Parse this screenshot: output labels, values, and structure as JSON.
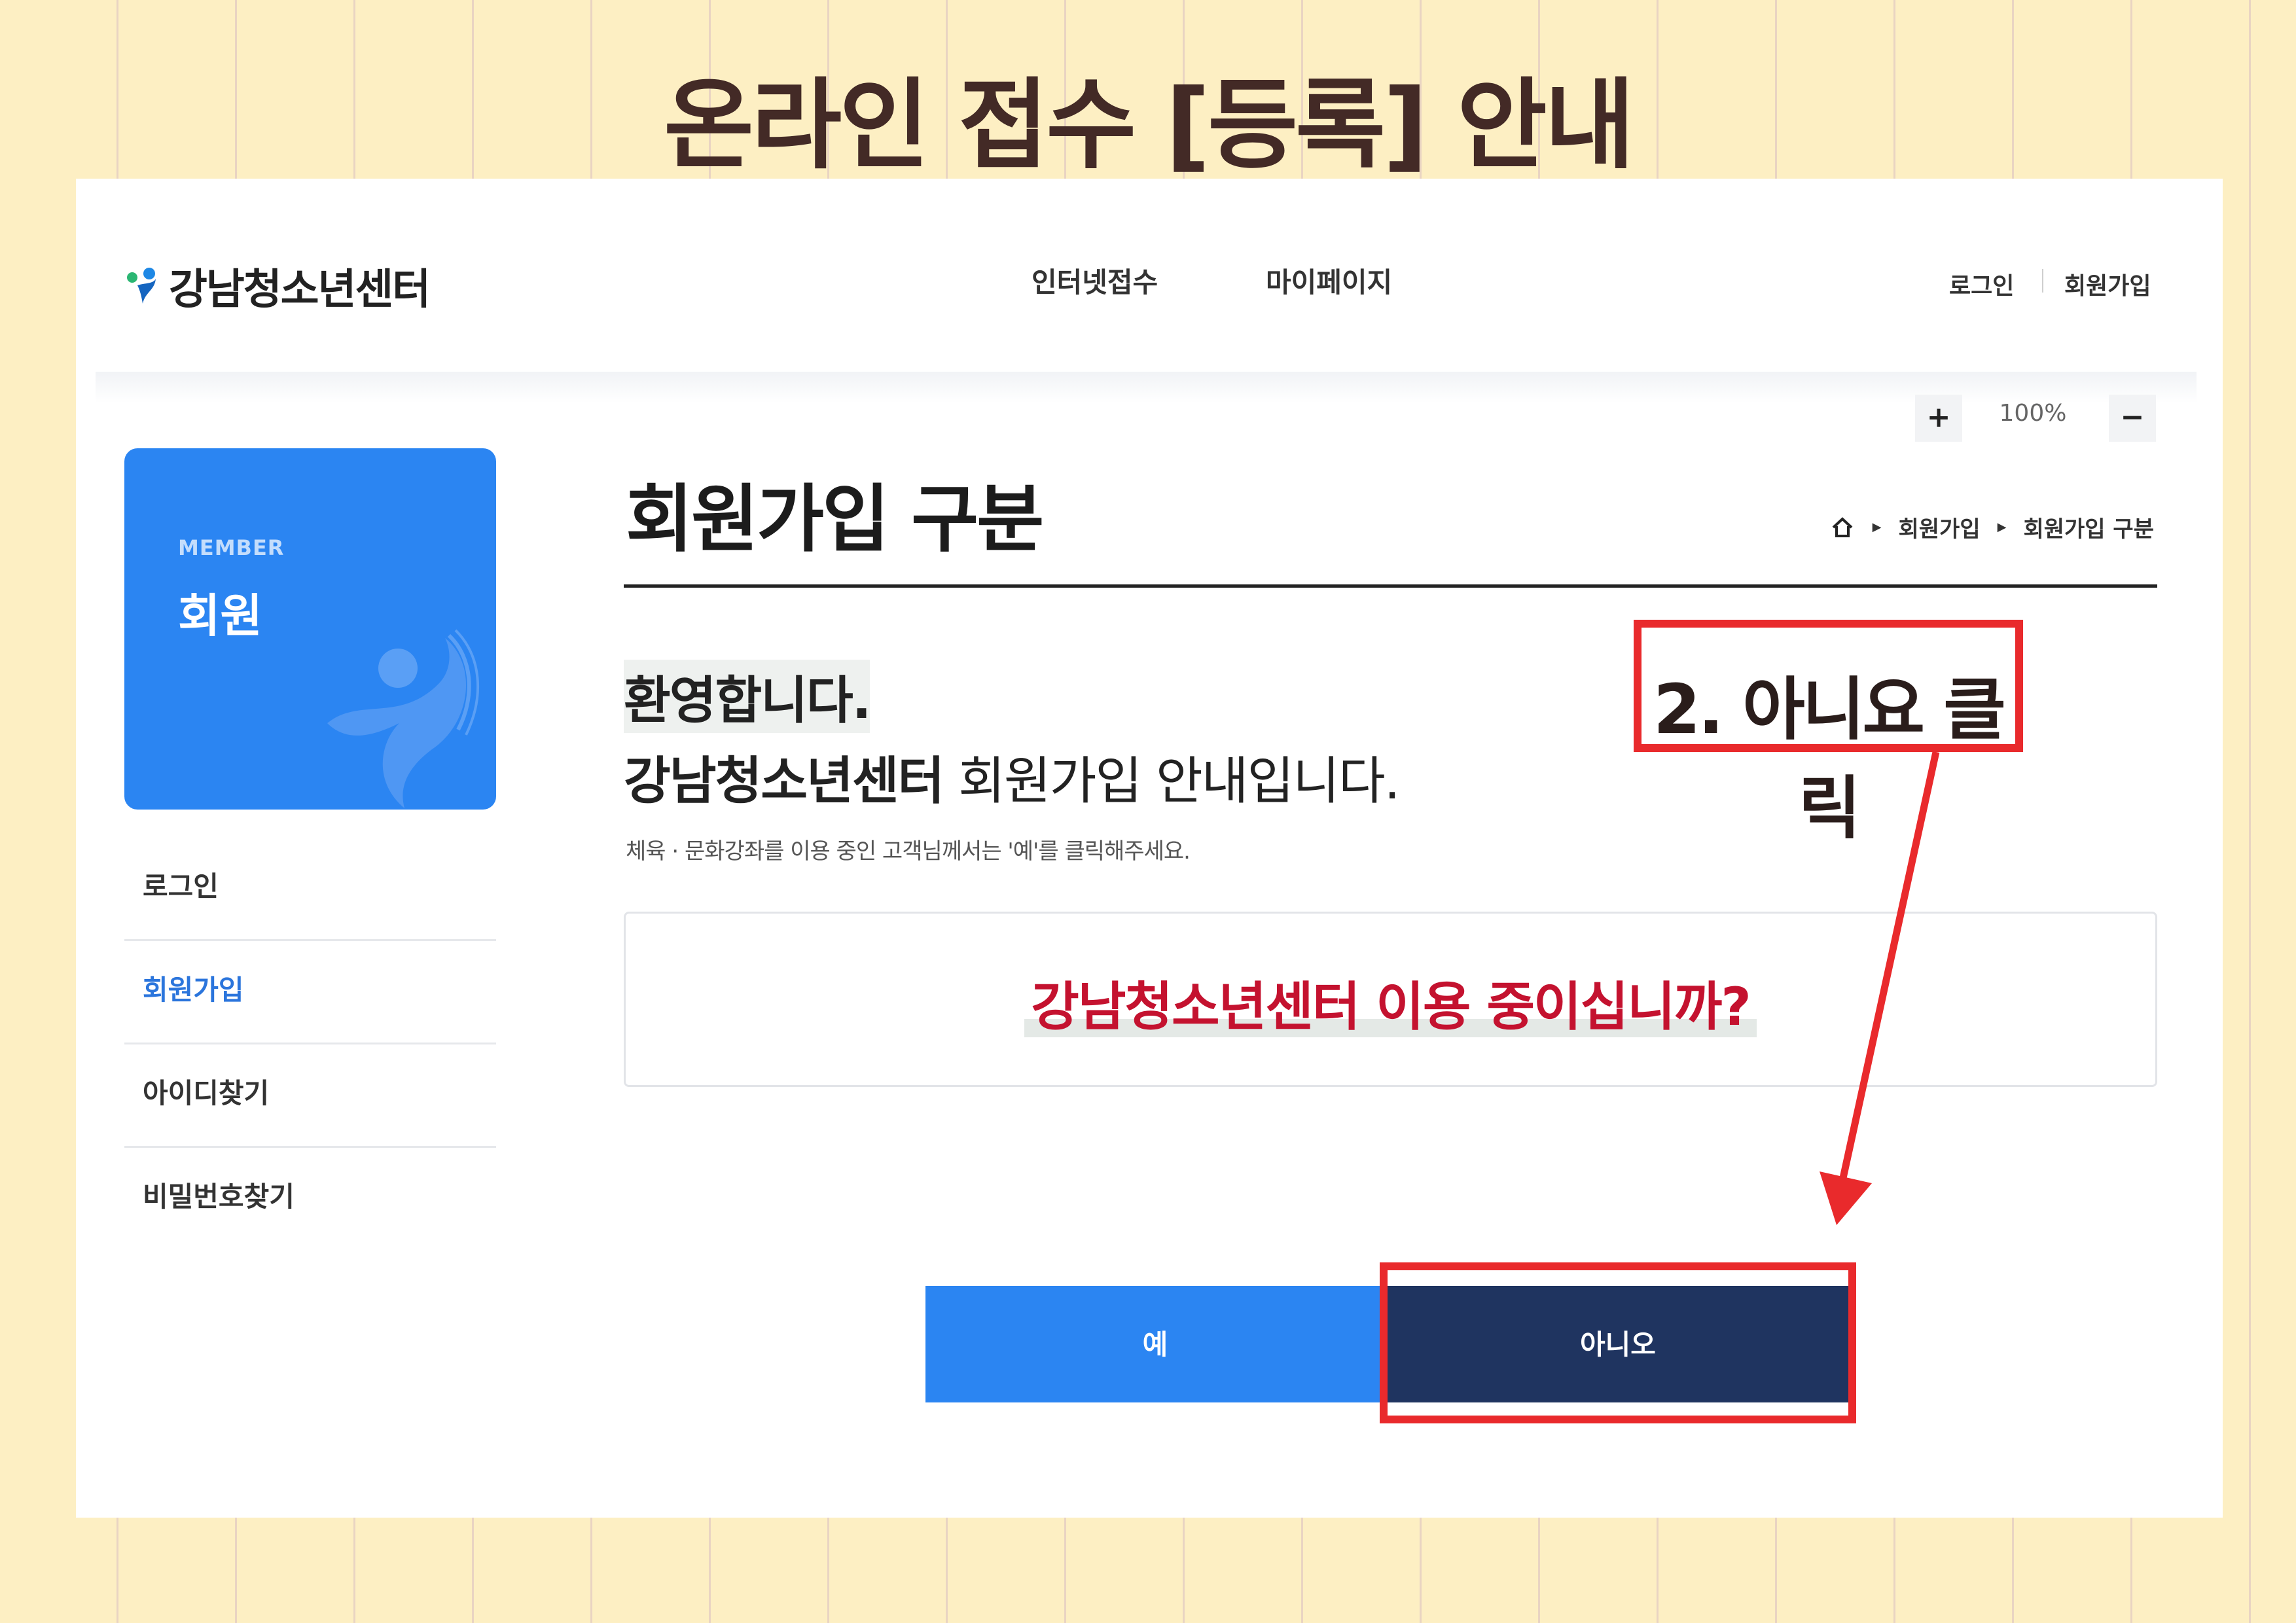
{
  "poster": {
    "title": "온라인 접수 [등록] 안내"
  },
  "header": {
    "logo_text": "강남청소년센터",
    "nav": [
      "인터넷접수",
      "마이페이지"
    ],
    "util": {
      "login": "로그인",
      "signup": "회원가입"
    }
  },
  "zoom": {
    "plus": "+",
    "level": "100%",
    "minus": "−"
  },
  "sidebar": {
    "card": {
      "eyebrow": "MEMBER",
      "heading": "회원"
    },
    "items": [
      {
        "label": "로그인",
        "active": false
      },
      {
        "label": "회원가입",
        "active": true
      },
      {
        "label": "아이디찾기",
        "active": false
      },
      {
        "label": "비밀번호찾기",
        "active": false
      }
    ]
  },
  "content": {
    "title": "회원가입 구분",
    "breadcrumb": [
      "회원가입",
      "회원가입 구분"
    ],
    "welcome": "환영합니다.",
    "intro_bold": "강남청소년센터",
    "intro_rest": " 회원가입 안내입니다.",
    "note": "체육 · 문화강좌를 이용 중인 고객님께서는 '예'를 클릭해주세요.",
    "question": "강남청소년센터 이용 중이십니까?",
    "buttons": {
      "yes": "예",
      "no": "아니오"
    }
  },
  "annotation": {
    "text": "2. 아니요 클릭",
    "color": "#e92a2c"
  },
  "colors": {
    "brand_blue": "#2b85f2",
    "navy": "#1f3460",
    "question_red": "#c4122f",
    "background": "#fdefc3"
  }
}
